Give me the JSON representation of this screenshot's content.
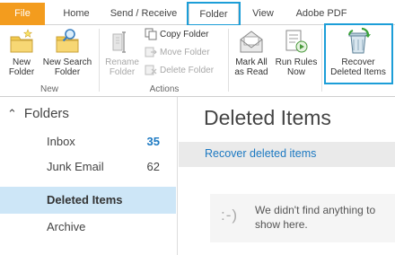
{
  "tabs": {
    "file": "File",
    "home": "Home",
    "send_receive": "Send / Receive",
    "folder": "Folder",
    "view": "View",
    "adobe_pdf": "Adobe PDF"
  },
  "ribbon": {
    "new_group": {
      "label": "New",
      "new_folder_line1": "New",
      "new_folder_line2": "Folder",
      "new_search_folder_line1": "New Search",
      "new_search_folder_line2": "Folder"
    },
    "actions_group": {
      "label": "Actions",
      "rename_folder_line1": "Rename",
      "rename_folder_line2": "Folder",
      "copy_folder": "Copy Folder",
      "move_folder": "Move Folder",
      "delete_folder": "Delete Folder"
    },
    "mark_all_as_read_line1": "Mark All",
    "mark_all_as_read_line2": "as Read",
    "run_rules_now_line1": "Run Rules",
    "run_rules_now_line2": "Now",
    "recover_deleted_items_line1": "Recover",
    "recover_deleted_items_line2": "Deleted Items"
  },
  "folders": {
    "header": "Folders",
    "items": [
      {
        "name": "Inbox",
        "count": "35"
      },
      {
        "name": "Junk Email",
        "count": "62"
      },
      {
        "name": "Deleted Items",
        "count": ""
      },
      {
        "name": "Archive",
        "count": ""
      }
    ]
  },
  "main": {
    "title": "Deleted Items",
    "recover_link": "Recover deleted items",
    "empty_icon": ":-)",
    "empty_message": "We didn't find anything to show here."
  },
  "colors": {
    "accent": "#1c9ed8",
    "file_tab": "#f39c1e",
    "link": "#1c79c2",
    "selected_folder": "#cde6f7"
  }
}
